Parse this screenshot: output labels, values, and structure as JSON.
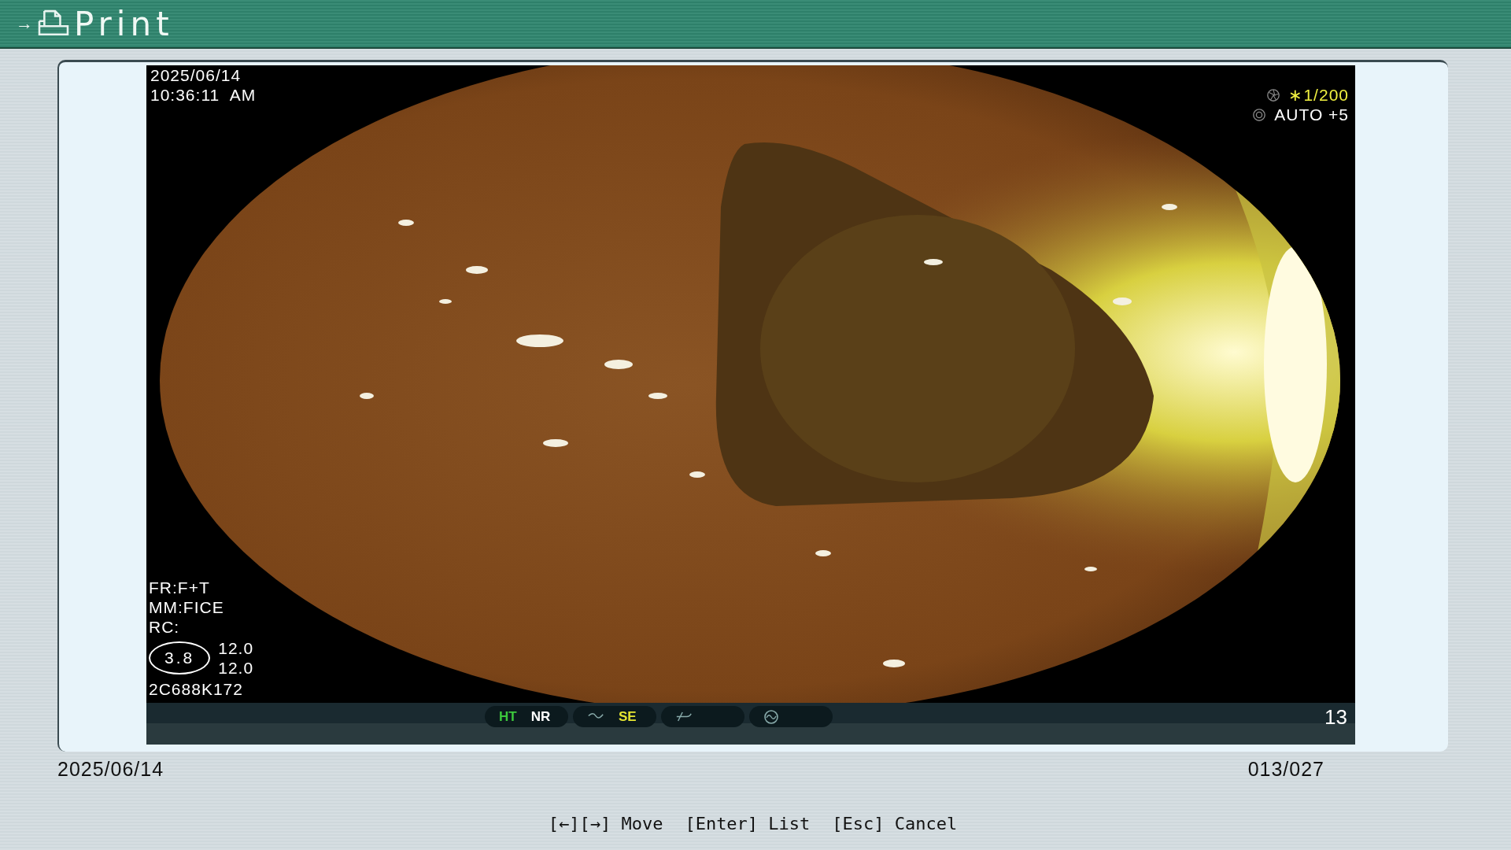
{
  "window": {
    "arrow": "→",
    "title": "Print"
  },
  "image": {
    "date": "2025/06/14",
    "time": "10:36:11  AM",
    "shutter": "∗1/200",
    "exposure": "AUTO +5",
    "info": [
      "FR:F+T",
      "MM:FICE",
      "RC:"
    ],
    "gauge": "3.8",
    "readings": [
      "12.0",
      "12.0"
    ],
    "scope_id": "2C688K172"
  },
  "status_bar": {
    "groups": [
      {
        "kind": "text",
        "items": [
          {
            "label": "HT",
            "color": "#3cc83c"
          },
          {
            "label": "NR",
            "color": "#ffffff"
          }
        ]
      },
      {
        "kind": "icon",
        "items": [
          {
            "label": "SE",
            "color": "#e6e632"
          }
        ]
      },
      {
        "kind": "icon"
      },
      {
        "kind": "circle"
      }
    ],
    "frame": "13"
  },
  "date": "2025/06/14",
  "counter": "013/027",
  "hints": [
    "[←][→] Move",
    "[Enter] List",
    "[Esc] Cancel"
  ]
}
